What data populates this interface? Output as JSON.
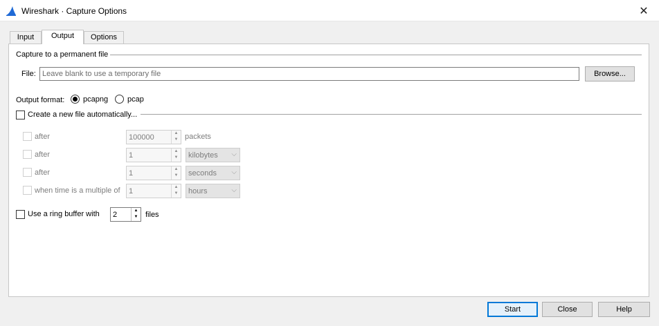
{
  "window": {
    "title": "Wireshark · Capture Options",
    "close_glyph": "✕",
    "app_icon": "wireshark-fin-icon"
  },
  "tabs": [
    {
      "label": "Input"
    },
    {
      "label": "Output"
    },
    {
      "label": "Options"
    }
  ],
  "active_tab": "Output",
  "capture_file": {
    "group_title": "Capture to a permanent file",
    "file_label": "File:",
    "file_value": "",
    "file_placeholder": "Leave blank to use a temporary file",
    "browse_label": "Browse..."
  },
  "output_format": {
    "label": "Output format:",
    "options": [
      {
        "label": "pcapng",
        "selected": true
      },
      {
        "label": "pcap",
        "selected": false
      }
    ]
  },
  "auto_new_file": {
    "label": "Create a new file automatically...",
    "checked": false,
    "rows": [
      {
        "label": "after",
        "value": "100000",
        "unit": "packets",
        "checked": false
      },
      {
        "label": "after",
        "value": "1",
        "unit": "kilobytes",
        "checked": false
      },
      {
        "label": "after",
        "value": "1",
        "unit": "seconds",
        "checked": false
      },
      {
        "label": "when time is a multiple of",
        "value": "1",
        "unit": "hours",
        "checked": false
      }
    ]
  },
  "ring_buffer": {
    "label": "Use a ring buffer with",
    "value": "2",
    "suffix": "files",
    "checked": false
  },
  "footer": {
    "start_label": "Start",
    "close_label": "Close",
    "help_label": "Help"
  },
  "colors": {
    "accent": "#0078d7",
    "wireshark_blue": "#1f6ad6"
  }
}
